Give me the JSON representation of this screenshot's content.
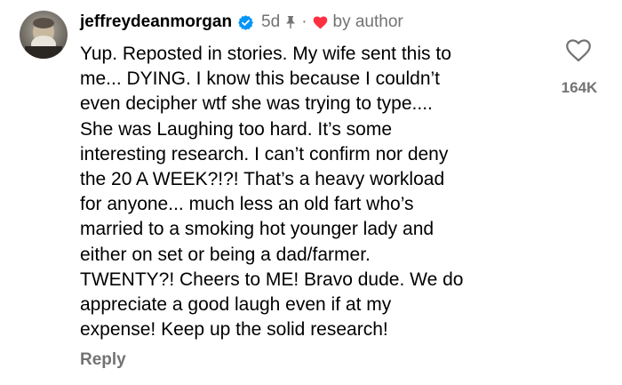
{
  "comment": {
    "username": "jeffreydeanmorgan",
    "verified_icon": "verified-badge-icon",
    "time_ago": "5d",
    "pinned_icon": "pin-icon",
    "separator": "·",
    "liked_by_author_icon": "heart-icon",
    "liked_by_label": "by author",
    "text": "Yup. Reposted in stories. My wife sent this to\nme... DYING. I know this because I couldn’t\neven decipher wtf she was trying to type....\nShe was Laughing too hard. It’s some\ninteresting research. I can’t confirm nor deny\nthe 20 A WEEK?!?! That’s a heavy workload\nfor anyone... much less an old fart who’s\nmarried to a smoking hot younger lady and\neither on set or being a dad/farmer.\nTWENTY?! Cheers to ME! Bravo dude. We do\nappreciate a good laugh even if at my\nexpense! Keep up the solid research!",
    "reply_label": "Reply",
    "like_count": "164K",
    "colors": {
      "verified": "#0095f6",
      "heart": "#ff3040",
      "secondary_text": "#737373"
    }
  }
}
